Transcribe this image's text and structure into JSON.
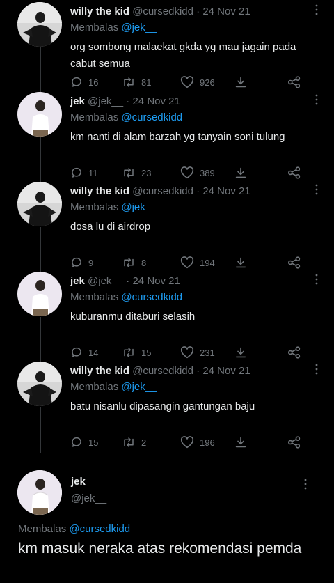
{
  "colors": {
    "background": "#000000",
    "text": "#e7e9ea",
    "muted": "#71767b",
    "link": "#1d9bf0",
    "thread_line": "#333639"
  },
  "icons": {
    "reply": "reply-icon",
    "retweet": "retweet-icon",
    "like": "heart-icon",
    "share": "share-icon",
    "bookmark": "bookmark-icon",
    "more": "more-icon"
  },
  "replies": [
    {
      "author": "willy the kid",
      "handle": "@cursedkidd",
      "date": "24 Nov 21",
      "reply_label": "Membalas",
      "reply_to": "@jek__",
      "text": "org sombong malaekat gkda yg mau jagain pada cabut semua",
      "replies": "16",
      "retweets": "81",
      "likes": "926"
    },
    {
      "author": "jek",
      "handle": "@jek__",
      "date": "24 Nov 21",
      "reply_label": "Membalas",
      "reply_to": "@cursedkidd",
      "text": "km nanti di alam barzah yg tanyain soni tulung",
      "replies": "11",
      "retweets": "23",
      "likes": "389"
    },
    {
      "author": "willy the kid",
      "handle": "@cursedkidd",
      "date": "24 Nov 21",
      "reply_label": "Membalas",
      "reply_to": "@jek__",
      "text": "dosa lu di airdrop",
      "replies": "9",
      "retweets": "8",
      "likes": "194"
    },
    {
      "author": "jek",
      "handle": "@jek__",
      "date": "24 Nov 21",
      "reply_label": "Membalas",
      "reply_to": "@cursedkidd",
      "text": "kuburanmu ditaburi selasih",
      "replies": "14",
      "retweets": "15",
      "likes": "231"
    },
    {
      "author": "willy the kid",
      "handle": "@cursedkidd",
      "date": "24 Nov 21",
      "reply_label": "Membalas",
      "reply_to": "@jek__",
      "text": "batu nisanlu dipasangin gantungan baju",
      "replies": "15",
      "retweets": "2",
      "likes": "196"
    }
  ],
  "main_tweet": {
    "author": "jek",
    "handle": "@jek__",
    "reply_label": "Membalas",
    "reply_to": "@cursedkidd",
    "text": "km masuk neraka atas rekomendasi pemda"
  }
}
